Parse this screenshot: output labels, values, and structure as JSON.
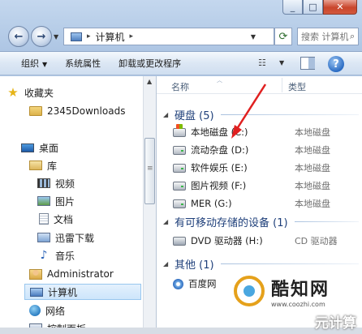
{
  "address_bar": {
    "crumb_icon": "computer-icon",
    "location": "计算机",
    "refresh_icon": "refresh-icon"
  },
  "search": {
    "placeholder": "搜索 计算机"
  },
  "toolbar": {
    "organize": "组织",
    "system_properties": "系统属性",
    "uninstall": "卸载或更改程序",
    "help": "?"
  },
  "nav_pane": {
    "favorites": "收藏夹",
    "downloads": "2345Downloads",
    "desktop": "桌面",
    "libraries": "库",
    "videos": "视频",
    "pictures": "图片",
    "documents": "文档",
    "thunder_downloads": "迅雷下载",
    "music": "音乐",
    "administrator": "Administrator",
    "computer": "计算机",
    "network": "网络",
    "control_panel": "控制面板"
  },
  "columns": {
    "name": "名称",
    "type": "类型"
  },
  "groups": {
    "hard_disks": {
      "title": "硬盘 (5)",
      "items": [
        {
          "name": "本地磁盘 (C:)",
          "type": "本地磁盘",
          "icon": "system-drive-icon"
        },
        {
          "name": "流动杂盘 (D:)",
          "type": "本地磁盘",
          "icon": "drive-icon"
        },
        {
          "name": "软件娱乐 (E:)",
          "type": "本地磁盘",
          "icon": "drive-icon"
        },
        {
          "name": "图片视频 (F:)",
          "type": "本地磁盘",
          "icon": "drive-icon"
        },
        {
          "name": "MER (G:)",
          "type": "本地磁盘",
          "icon": "drive-icon"
        }
      ]
    },
    "removable": {
      "title": "有可移动存储的设备 (1)",
      "items": [
        {
          "name": "DVD 驱动器 (H:)",
          "type": "CD 驱动器",
          "icon": "dvd-drive-icon"
        }
      ]
    },
    "other": {
      "title": "其他 (1)",
      "items": [
        {
          "name": "百度网",
          "type": "",
          "icon": "network-location-icon"
        }
      ]
    }
  },
  "watermark": {
    "brand": "酷知网",
    "url": "www.coozhi.com",
    "corner": "元计算"
  },
  "colors": {
    "annotation_arrow": "#e02020",
    "group_title": "#1e3f7a",
    "selection": "#cde5fb"
  }
}
